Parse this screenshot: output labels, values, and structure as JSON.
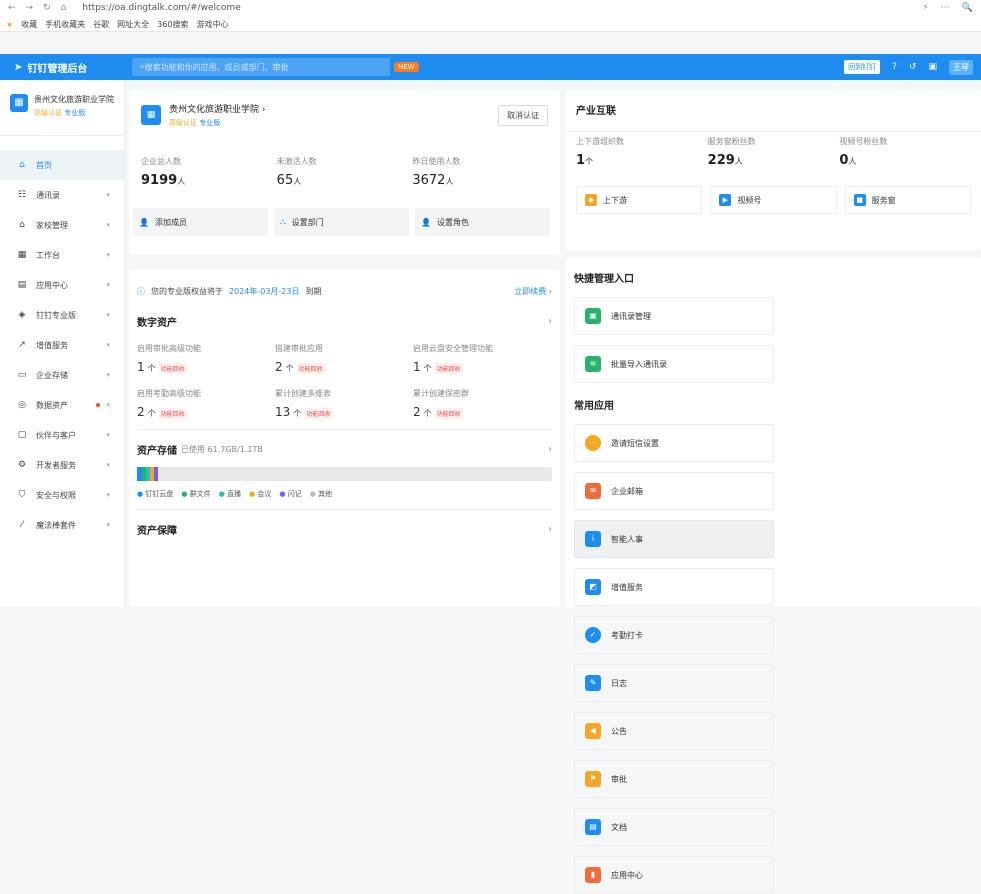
{
  "browser": {
    "url": "https://oa.dingtalk.com/#/welcome",
    "bookmarks": [
      "收藏",
      "手机收藏夹",
      "谷歌",
      "网址大全",
      "360搜索",
      "游戏中心"
    ]
  },
  "topbar": {
    "title": "钉钉管理后台",
    "search_placeholder": "搜索功能和你的应用、成员或部门、审批",
    "new_badge": "NEW",
    "return_btn": "回到钉钉",
    "user": "王琴"
  },
  "org": {
    "name": "贵州文化旅游职业学院",
    "tag1": "高级认证",
    "tag2": "专业版"
  },
  "nav": [
    {
      "label": "首页"
    },
    {
      "label": "通讯录"
    },
    {
      "label": "家校管理"
    },
    {
      "label": "工作台"
    },
    {
      "label": "应用中心"
    },
    {
      "label": "钉钉专业版"
    },
    {
      "label": "增值服务"
    },
    {
      "label": "企业存储"
    },
    {
      "label": "数据资产"
    },
    {
      "label": "伙伴与客户"
    },
    {
      "label": "开发者服务"
    },
    {
      "label": "安全与权限"
    },
    {
      "label": "魔法棒套件"
    }
  ],
  "overview": {
    "title": "贵州文化旅游职业学院 ›",
    "tag1": "高级认证",
    "tag2": "专业版",
    "cancel": "取消认证",
    "stats": [
      {
        "label": "企业总人数",
        "value": "9199",
        "unit": "人"
      },
      {
        "label": "未激活人数",
        "value": "65",
        "unit": "人"
      },
      {
        "label": "昨日使用人数",
        "value": "3672",
        "unit": "人"
      }
    ],
    "actions": [
      "添加成员",
      "设置部门",
      "设置角色"
    ]
  },
  "digital": {
    "notice_pre": "您的专业版权益将于",
    "notice_date": "2024年-03月-23日",
    "notice_post": "到期",
    "renew": "立即续费 ›",
    "title": "数字资产",
    "items": [
      {
        "label": "启用审批高级功能",
        "value": "1",
        "unit": "个",
        "badge": "功能回收"
      },
      {
        "label": "搭建审批应用",
        "value": "2",
        "unit": "个",
        "badge": "功能回收"
      },
      {
        "label": "启用云盘安全管理功能",
        "value": "1",
        "unit": "个",
        "badge": "功能回收"
      },
      {
        "label": "启用考勤高级功能",
        "value": "2",
        "unit": "个",
        "badge": "功能回收"
      },
      {
        "label": "累计创建多维表",
        "value": "13",
        "unit": "个",
        "badge": "功能回收"
      },
      {
        "label": "累计创建保密群",
        "value": "2",
        "unit": "个",
        "badge": "功能回收"
      }
    ],
    "storage_title": "资产存储",
    "storage_sub": "已使用 61.7GB/1.1TB",
    "storage_used_fraction": 0.056,
    "legend": [
      "钉钉云盘",
      "群文件",
      "直播",
      "会议",
      "闪记",
      "其他"
    ],
    "guarantee": "资产保障"
  },
  "industry": {
    "title": "产业互联",
    "stats": [
      {
        "label": "上下游组织数",
        "value": "1",
        "unit": "个"
      },
      {
        "label": "服务窗粉丝数",
        "value": "229",
        "unit": "人"
      },
      {
        "label": "视频号粉丝数",
        "value": "0",
        "unit": "人"
      }
    ],
    "buttons": [
      "上下游",
      "视频号",
      "服务窗"
    ]
  },
  "quick": {
    "title": "快捷管理入口",
    "entries": [
      "通讯录管理",
      "批量导入通讯录"
    ],
    "common_title": "常用应用",
    "apps": [
      "邀请短信设置",
      "企业邮箱",
      "智能人事",
      "增值服务",
      "考勤打卡",
      "日志",
      "公告",
      "审批",
      "文档",
      "应用中心"
    ]
  }
}
